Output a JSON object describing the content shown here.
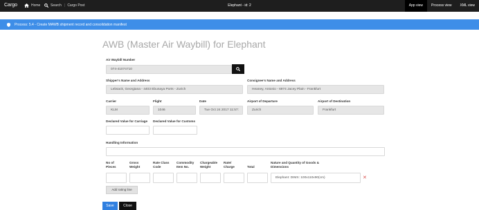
{
  "topbar": {
    "brand": "Cargo",
    "nav_home": "Home",
    "nav_search": "Search",
    "nav_cargo_post": "Cargo Post",
    "title": "Elephant - id: 2",
    "views": [
      "App view",
      "Process view",
      "XML view"
    ]
  },
  "process": {
    "label": "Process: 5.4 - Create MAWB shipment record and consolidation manifest"
  },
  "page": {
    "title": "AWB (Master Air Waybill) for Elephant"
  },
  "fields": {
    "awb_label": "Air Waybill Number",
    "awb_value": "074-41074710",
    "shipper_label": "Shipper's Name and Address",
    "shipper_value": "Lebsack, Georgiana - 4403 Ebunaya Ports - Zurich",
    "consignee_label": "Consignee's Name and Address",
    "consignee_value": "Heaney, Antonio - 6974 Jacey Plain - Frankfurt",
    "carrier_label": "Carrier",
    "carrier_value": "KLM",
    "flight_label": "Flight",
    "flight_value": "1046",
    "date_label": "Date",
    "date_value": "Tue Oct 24 2017 11:57:",
    "departure_label": "Airport of Departure",
    "departure_value": "Zurich",
    "destination_label": "Airport of Destination",
    "destination_value": "Frankfurt",
    "carriage_label": "Declared Value for Carriage",
    "customs_label": "Declared Value for Customs",
    "handling_label": "Handling Information"
  },
  "rating": {
    "col_pieces": "No of Pieces",
    "col_gross": "Gross Weight",
    "col_rate_class": "Rate Class Code",
    "col_commodity": "Commodity Item No.",
    "col_chargeable": "Chargeable Weight",
    "col_rate": "Rate/ Charge",
    "col_total": "Total",
    "col_nature": "Nature and Quantity of Goods & Dimensions",
    "nature_value": "Elephant: DIMS: 100x110x90(cm)",
    "add_label": "Add rating line"
  },
  "actions": {
    "save": "Save",
    "close": "Close"
  }
}
